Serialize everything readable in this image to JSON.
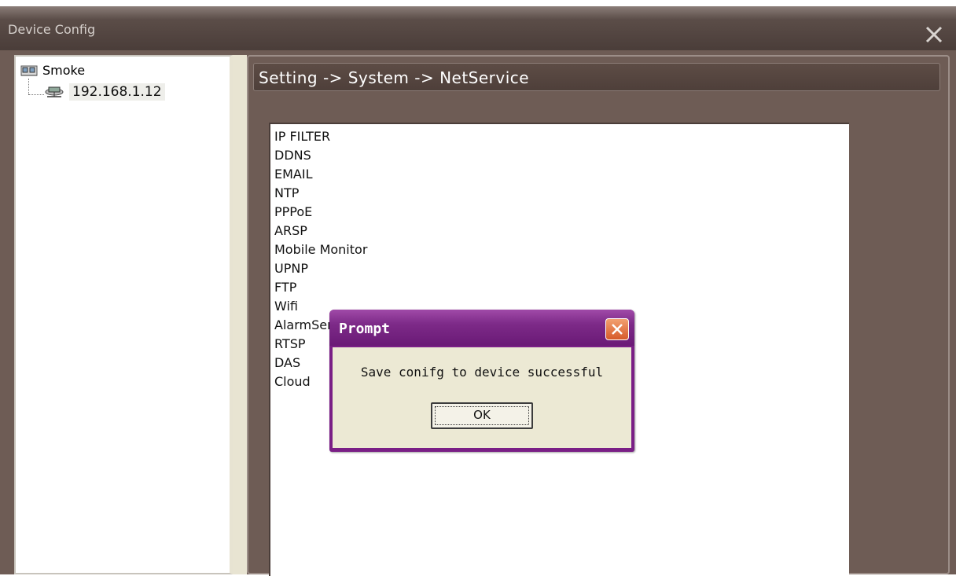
{
  "window": {
    "title": "Device Config",
    "close_icon": "close-icon"
  },
  "tree": {
    "root": {
      "label": "Smoke",
      "icon": "device-group-icon"
    },
    "child": {
      "label": "192.168.1.12",
      "icon": "network-device-icon"
    }
  },
  "breadcrumb": "Setting -> System -> NetService",
  "services": [
    "IP FILTER",
    "DDNS",
    "EMAIL",
    "NTP",
    "PPPoE",
    "ARSP",
    "Mobile Monitor",
    "UPNP",
    "FTP",
    "Wifi",
    "AlarmServer",
    "RTSP",
    "DAS",
    "Cloud"
  ],
  "dialog": {
    "title": "Prompt",
    "message": "Save conifg to device successful",
    "ok_label": "OK",
    "close_icon": "close-icon"
  },
  "colors": {
    "window_bg": "#6e5c55",
    "dialog_border": "#7a1f86",
    "dialog_body": "#ece9d4",
    "dialog_close": "#d65a2a"
  }
}
